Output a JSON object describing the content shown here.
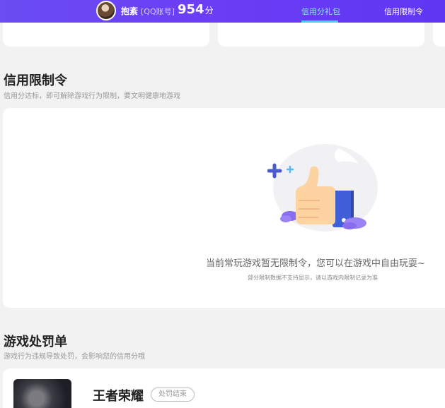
{
  "header": {
    "username": "抱紊",
    "account_type": "[QQ账号]",
    "score_value": "954",
    "score_unit": "分",
    "tabs": [
      {
        "label": "信用分礼包",
        "active": true
      },
      {
        "label": "信用限制令",
        "active": false
      }
    ]
  },
  "restriction_section": {
    "title": "信用限制令",
    "subtitle": "信用分达标，即可解除游戏行为限制，要文明健康地游戏",
    "empty_message": "当前常玩游戏暂无限制令，您可以在游戏中自由玩耍~",
    "empty_note": "部分限制数据不支持显示，请以游戏内限制记录为准"
  },
  "penalty_section": {
    "title": "游戏处罚单",
    "subtitle": "游戏行为违规导致处罚，会影响您的信用分哦",
    "items": [
      {
        "game_name": "王者荣耀",
        "status": "处罚结束"
      }
    ]
  },
  "colors": {
    "header_bg": "#6b3df5",
    "active_tab": "#8fe4ff",
    "thumbs_up_hand": "#fcd3a1",
    "thumbs_up_cuff": "#3f5fd8"
  }
}
